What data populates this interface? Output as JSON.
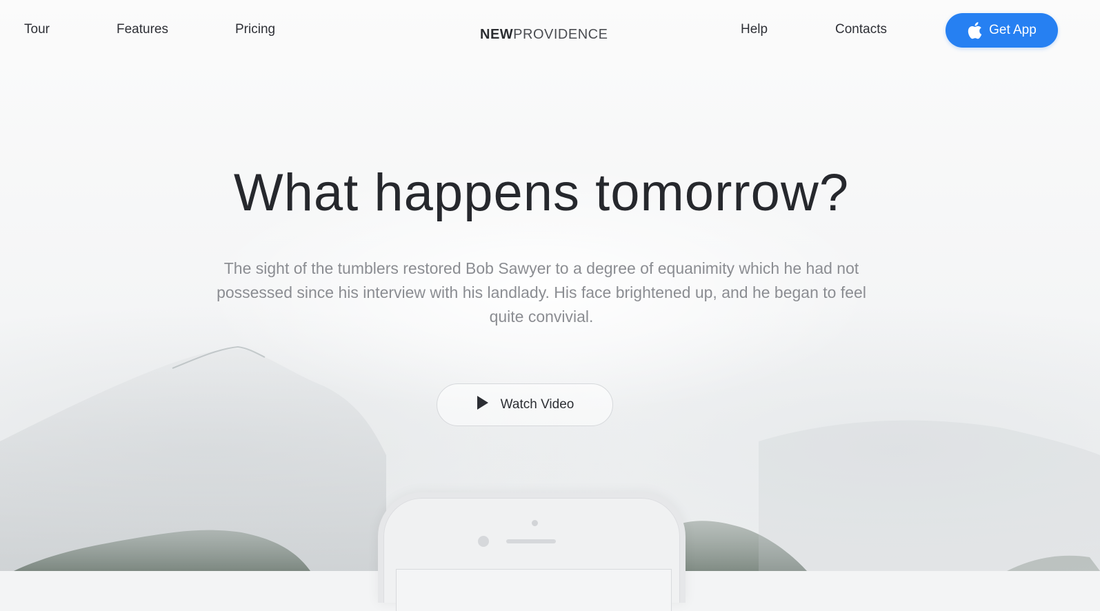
{
  "nav": {
    "left": [
      "Tour",
      "Features",
      "Pricing"
    ],
    "right": [
      "Help",
      "Contacts"
    ],
    "brand_bold": "NEW",
    "brand_light": "PROVIDENCE",
    "cta_label": "Get App",
    "cta_icon": "apple-icon"
  },
  "hero": {
    "headline": "What happens tomorrow?",
    "subtext": "The sight of the tumblers restored Bob Sawyer to a degree of equanimity which he had not possessed since his interview with his landlady. His face brightened up, and he began to feel quite convivial.",
    "video_label": "Watch Video",
    "video_icon": "play-icon"
  },
  "colors": {
    "accent": "#2680f2",
    "headline": "#26282d",
    "subtext": "#8b8d92",
    "background": "#f3f4f5"
  }
}
